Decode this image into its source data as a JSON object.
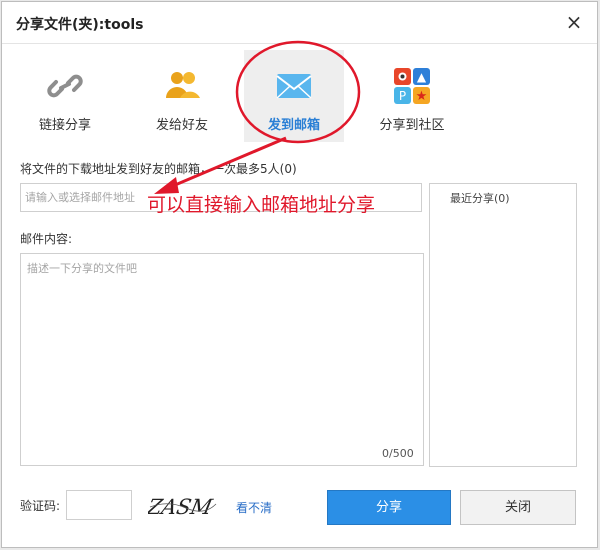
{
  "window": {
    "title": "分享文件(夹):tools",
    "close_label": "×"
  },
  "tabs": [
    {
      "label": "链接分享",
      "icon": "link-icon"
    },
    {
      "label": "发给好友",
      "icon": "friends-icon"
    },
    {
      "label": "发到邮箱",
      "icon": "mail-icon",
      "active": true
    },
    {
      "label": "分享到社区",
      "icon": "community-icon"
    }
  ],
  "form": {
    "recipients_hint": "将文件的下载地址发到好友的邮箱，一次最多5人(0)",
    "email_placeholder": "请输入或选择邮件地址",
    "recent_label": "最近分享(0)",
    "content_label": "邮件内容:",
    "content_placeholder": "描述一下分享的文件吧",
    "char_count": "0/500",
    "captcha_label": "验证码:",
    "captcha_text": "ZASM",
    "captcha_refresh": "看不清"
  },
  "buttons": {
    "share": "分享",
    "close": "关闭"
  },
  "annotation": {
    "text": "可以直接输入邮箱地址分享"
  },
  "colors": {
    "accent": "#2b8fe6",
    "annotation": "#e0182b",
    "active_tab_text": "#2a7fd5"
  }
}
